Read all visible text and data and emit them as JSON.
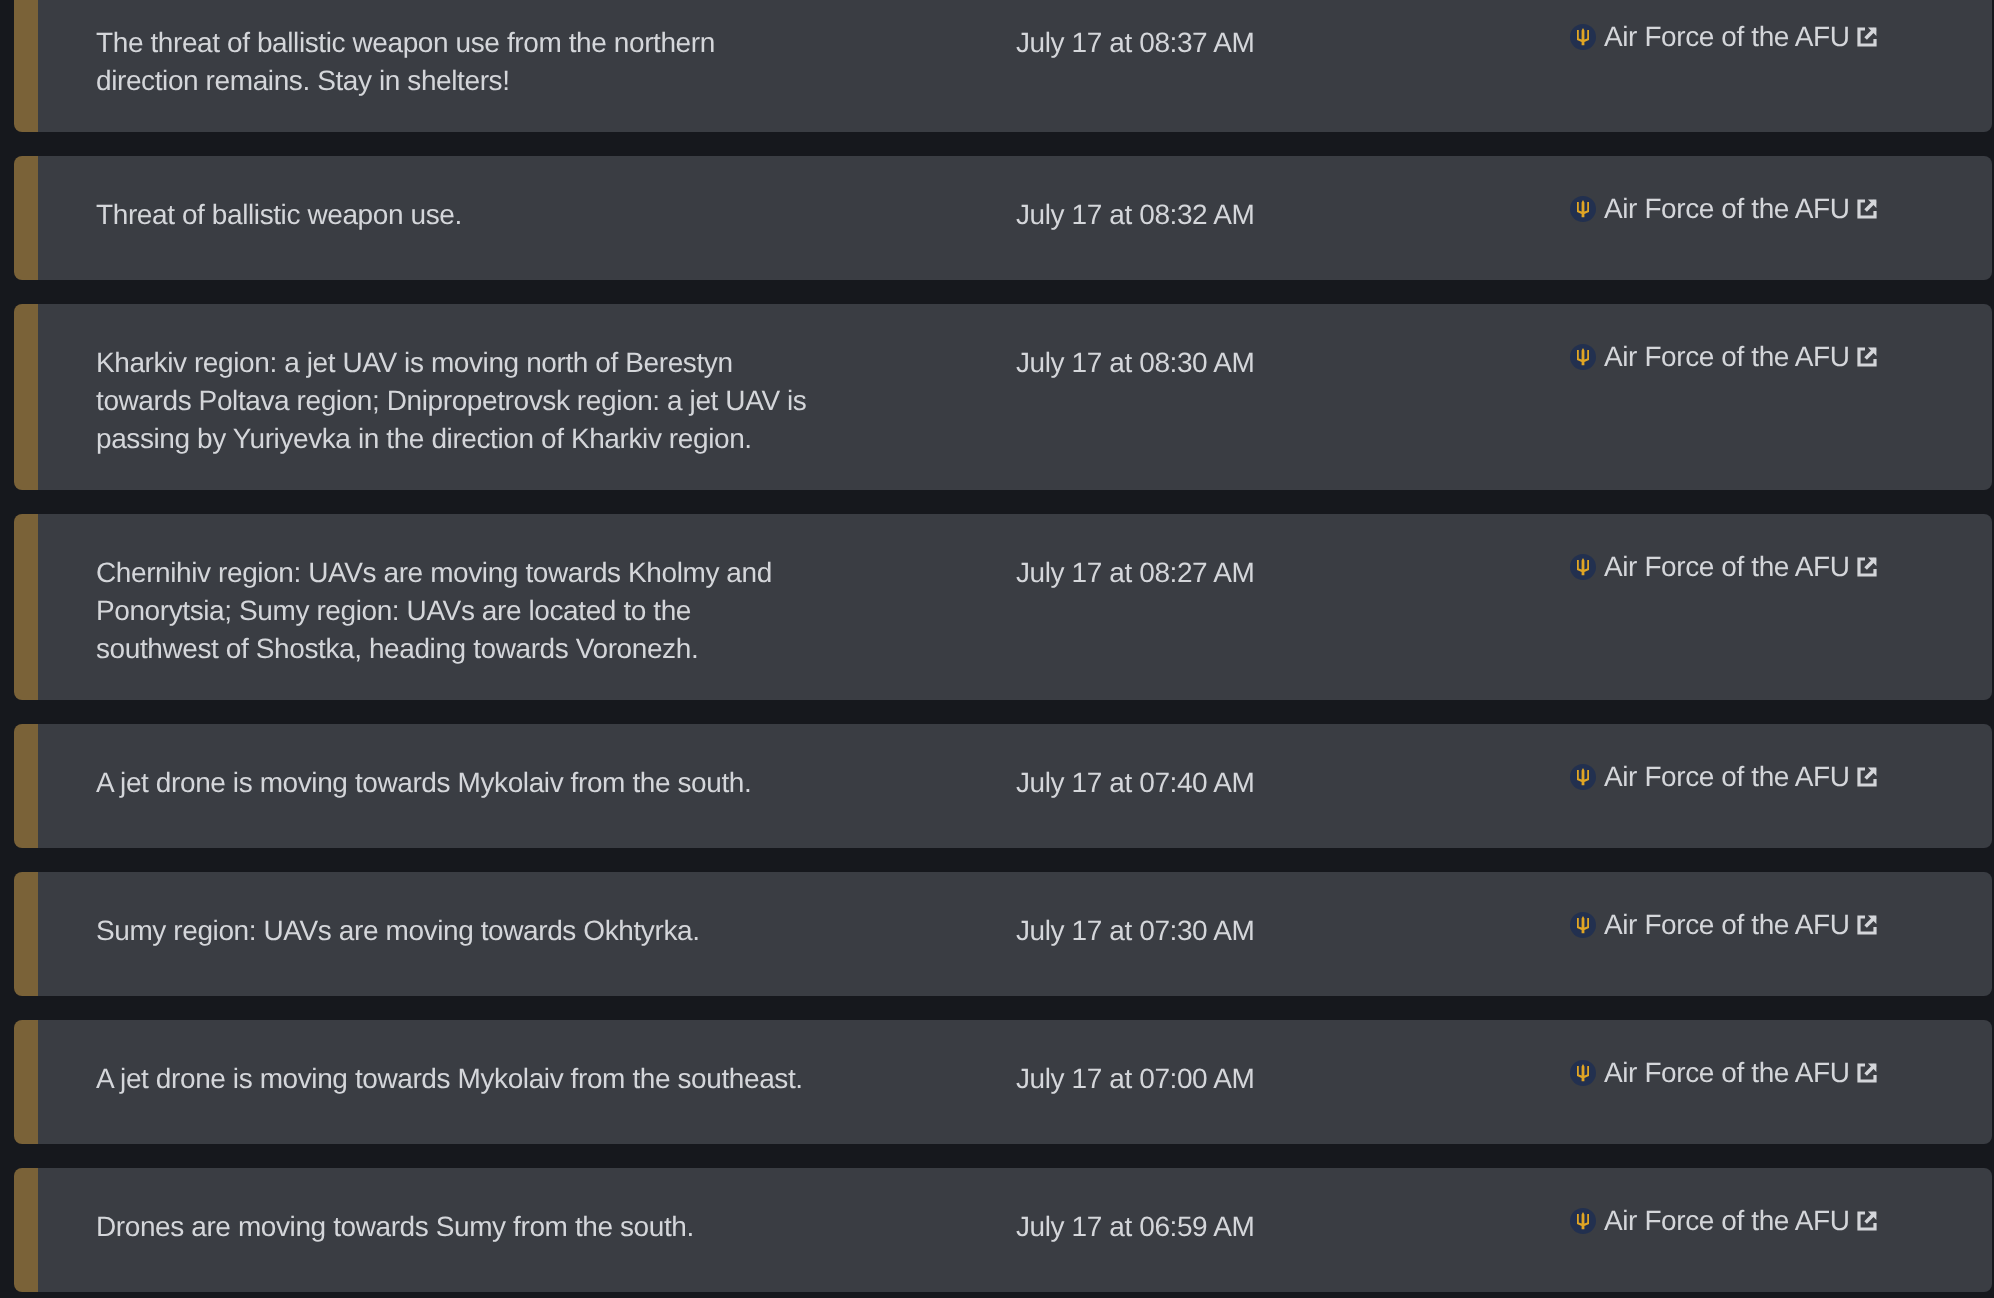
{
  "messages": [
    {
      "text": "The threat of ballistic weapon use from the northern direction remains. Stay in shelters!",
      "time": "July 17 at 08:37 AM",
      "source": "Air Force of the AFU"
    },
    {
      "text": "Threat of ballistic weapon use.",
      "time": "July 17 at 08:32 AM",
      "source": "Air Force of the AFU"
    },
    {
      "text": "Kharkiv region: a jet UAV is moving north of Berestyn towards Poltava region; Dnipropetrovsk region: a jet UAV is passing by Yuriyevka in the direction of Kharkiv region.",
      "time": "July 17 at 08:30 AM",
      "source": "Air Force of the AFU"
    },
    {
      "text": "Chernihiv region: UAVs are moving towards Kholmy and Ponorytsia; Sumy region: UAVs are located to the southwest of Shostka, heading towards Voronezh.",
      "time": "July 17 at 08:27 AM",
      "source": "Air Force of the AFU"
    },
    {
      "text": "A jet drone is moving towards Mykolaiv from the south.",
      "time": "July 17 at 07:40 AM",
      "source": "Air Force of the AFU"
    },
    {
      "text": "Sumy region: UAVs are moving towards Okhtyrka.",
      "time": "July 17 at 07:30 AM",
      "source": "Air Force of the AFU"
    },
    {
      "text": "A jet drone is moving towards Mykolaiv from the southeast.",
      "time": "July 17 at 07:00 AM",
      "source": "Air Force of the AFU"
    },
    {
      "text": "Drones are moving towards Sumy from the south.",
      "time": "July 17 at 06:59 AM",
      "source": "Air Force of the AFU"
    }
  ]
}
